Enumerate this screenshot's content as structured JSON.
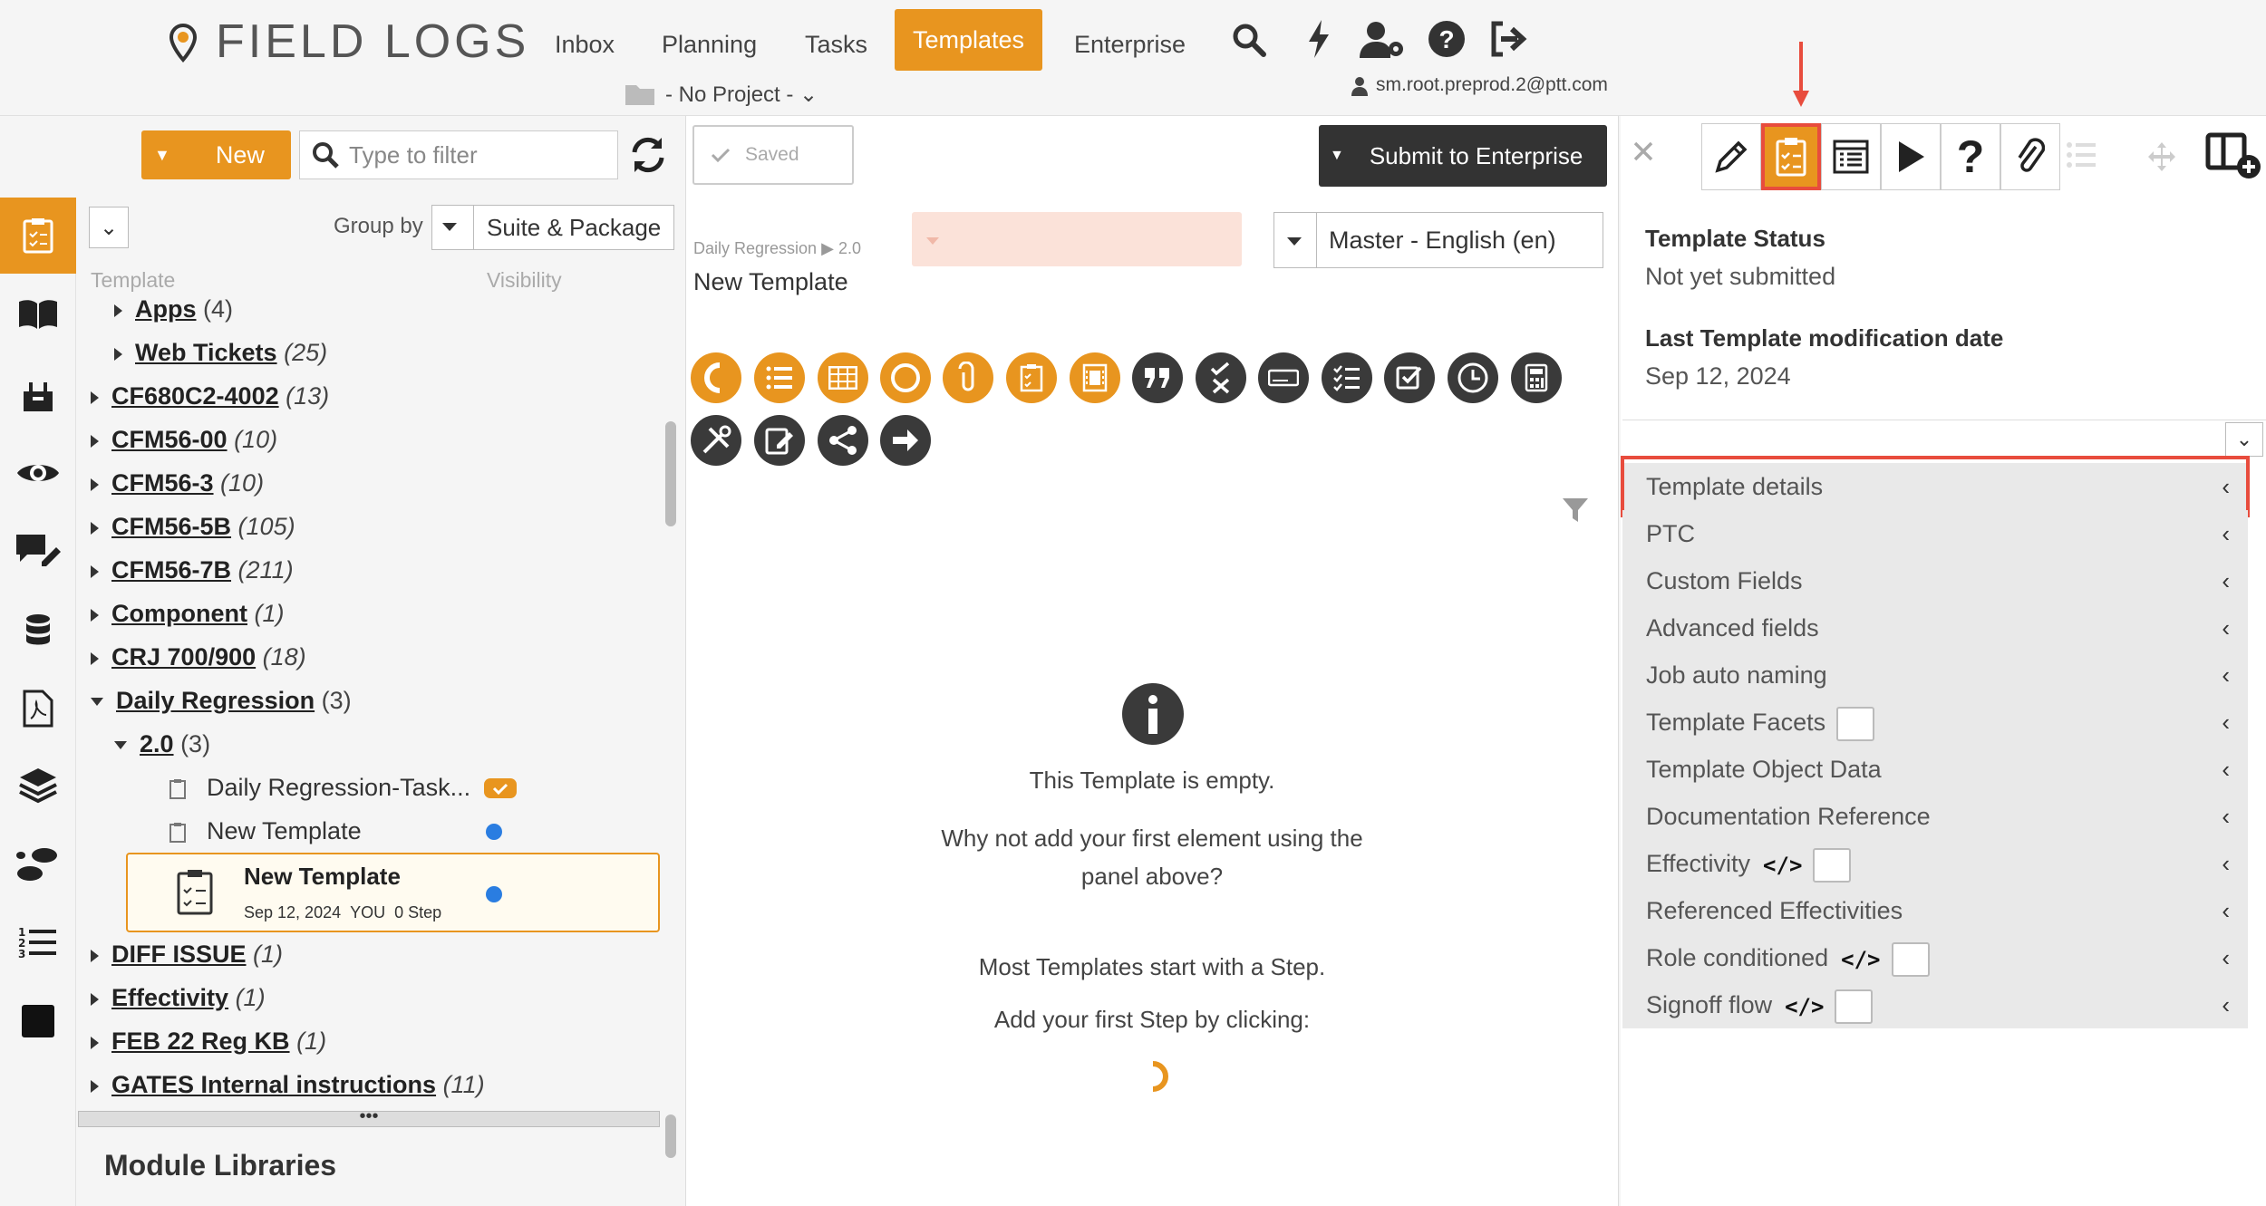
{
  "app": {
    "logo_text": "FIELD LOGS"
  },
  "nav": {
    "items": [
      "Inbox",
      "Planning",
      "Tasks",
      "Templates",
      "Enterprise"
    ],
    "active": "Templates",
    "project": "- No Project -",
    "user": "sm.root.preprod.2@ptt.com"
  },
  "toolbar": {
    "new_label": "New",
    "filter_placeholder": "Type to filter",
    "saved_label": "Saved",
    "submit_label": "Submit to Enterprise"
  },
  "tree": {
    "group_by_label": "Group by",
    "group_by_value": "Suite & Package",
    "col_template": "Template",
    "col_visibility": "Visibility",
    "rows": [
      {
        "label": "Apps",
        "count": "(4)"
      },
      {
        "label": "Web Tickets",
        "count": "(25)"
      },
      {
        "label": "CF680C2-4002",
        "count": "(13)"
      },
      {
        "label": "CFM56-00",
        "count": "(10)"
      },
      {
        "label": "CFM56-3",
        "count": "(10)"
      },
      {
        "label": "CFM56-5B",
        "count": "(105)"
      },
      {
        "label": "CFM56-7B",
        "count": "(211)"
      },
      {
        "label": "Component",
        "count": "(1)"
      },
      {
        "label": "CRJ 700/900",
        "count": "(18)"
      },
      {
        "label": "Daily Regression",
        "count": "(3)"
      },
      {
        "label": "2.0",
        "count": "(3)"
      },
      {
        "label": "DIFF ISSUE",
        "count": "(1)"
      },
      {
        "label": "Effectivity",
        "count": "(1)"
      },
      {
        "label": "FEB 22 Reg KB",
        "count": "(1)"
      },
      {
        "label": "GATES Internal instructions",
        "count": "(11)"
      }
    ],
    "leaf1": "Daily Regression-Task...",
    "leaf2": "New Template",
    "selected": {
      "title": "New Template",
      "date": "Sep 12, 2024",
      "who": "YOU",
      "steps": "0 Step"
    },
    "module_libraries": "Module Libraries"
  },
  "center": {
    "breadcrumb_suite": "Daily Regression",
    "breadcrumb_version": "2.0",
    "template_name": "New Template",
    "language": "Master - English (en)",
    "empty_title": "This Template is empty.",
    "empty_hint": "Why not add your first element using the panel above?",
    "step_hint": "Most Templates start with a Step.",
    "step_action": "Add your first Step by clicking:"
  },
  "right": {
    "status_label": "Template Status",
    "status_value": "Not yet submitted",
    "mod_label": "Last Template modification date",
    "mod_value": "Sep 12, 2024",
    "sections": [
      "Template details",
      "PTC",
      "Custom Fields",
      "Advanced fields",
      "Job auto naming",
      "Template Facets",
      "Template Object Data",
      "Documentation Reference",
      "Effectivity",
      "Referenced Effectivities",
      "Role conditioned",
      "Signoff flow"
    ]
  },
  "colors": {
    "accent": "#e8951f",
    "highlight": "#e84c3d",
    "dot": "#2a7de1"
  }
}
